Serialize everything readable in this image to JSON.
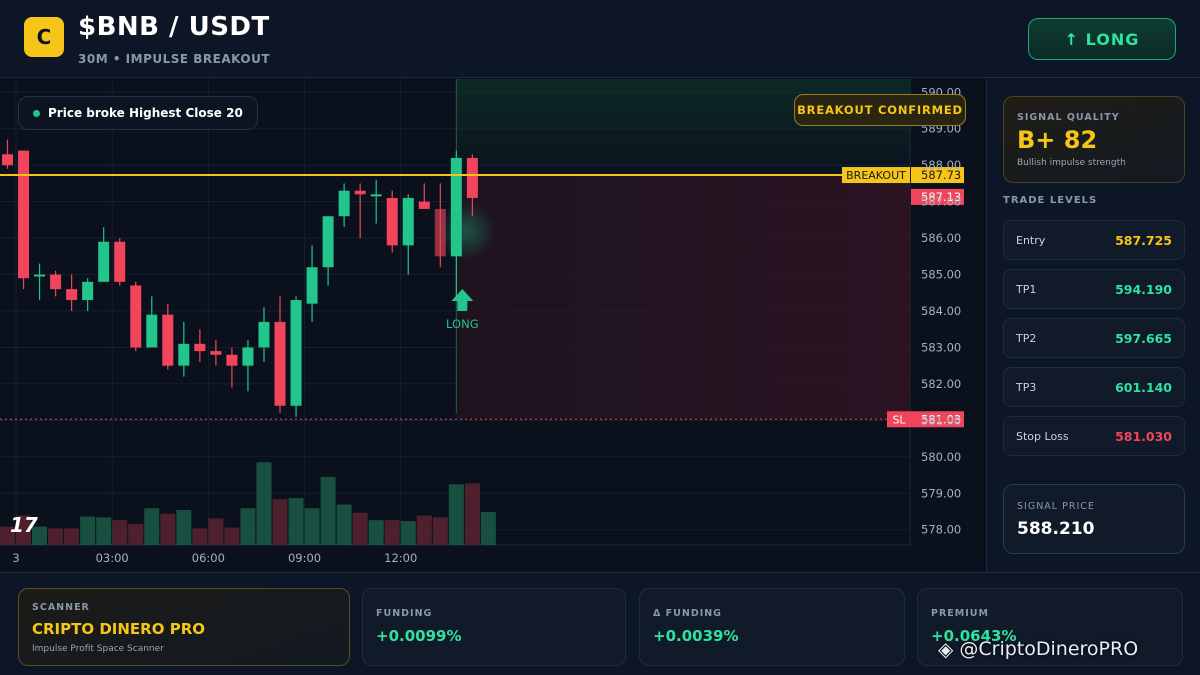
{
  "header": {
    "logo_letter": "C",
    "title": "$BNB / USDT",
    "subtitle": "30M • IMPULSE BREAKOUT",
    "long_button": "↑ LONG"
  },
  "chart": {
    "note": "Price broke Highest Close 20",
    "breakout_badge": "BREAKOUT CONFIRMED",
    "tv_logo": "17",
    "breakout_line_label": "BREAKOUT",
    "breakout_level": "587.73",
    "current_price_tag": "587.13",
    "sl_label": "SL",
    "sl_level": "581.03",
    "signal_arrow_label": "LONG",
    "colors": {
      "up": "#22c58b",
      "down": "#f2455b",
      "breakout": "#f5c518",
      "sl": "#f2455b"
    }
  },
  "chart_data": {
    "type": "candlestick",
    "price_axis_ticks": [
      "590.00",
      "589.00",
      "588.00",
      "587.00",
      "586.00",
      "585.00",
      "584.00",
      "583.00",
      "582.00",
      "581.00",
      "580.00",
      "579.00",
      "578.00"
    ],
    "ylim": [
      577.8,
      590.2
    ],
    "time_axis_ticks": [
      {
        "label": "3",
        "index": 1
      },
      {
        "label": "03:00",
        "index": 7
      },
      {
        "label": "06:00",
        "index": 13
      },
      {
        "label": "09:00",
        "index": 19
      },
      {
        "label": "12:00",
        "index": 25
      }
    ],
    "candles": [
      {
        "o": 588.3,
        "h": 588.7,
        "c": 588.0,
        "l": 587.9
      },
      {
        "o": 588.4,
        "h": 588.4,
        "c": 584.9,
        "l": 584.6
      },
      {
        "o": 585.0,
        "h": 585.3,
        "c": 585.0,
        "l": 584.3
      },
      {
        "o": 585.0,
        "h": 585.1,
        "c": 584.6,
        "l": 584.4
      },
      {
        "o": 584.6,
        "h": 585.0,
        "c": 584.3,
        "l": 584.0
      },
      {
        "o": 584.3,
        "h": 584.9,
        "c": 584.8,
        "l": 584.0
      },
      {
        "o": 584.8,
        "h": 586.3,
        "c": 585.9,
        "l": 584.8
      },
      {
        "o": 585.9,
        "h": 586.0,
        "c": 584.8,
        "l": 584.7
      },
      {
        "o": 584.7,
        "h": 584.8,
        "c": 583.0,
        "l": 582.9
      },
      {
        "o": 583.0,
        "h": 584.4,
        "c": 583.9,
        "l": 583.0
      },
      {
        "o": 583.9,
        "h": 584.2,
        "c": 582.5,
        "l": 582.4
      },
      {
        "o": 582.5,
        "h": 583.7,
        "c": 583.1,
        "l": 582.2
      },
      {
        "o": 583.1,
        "h": 583.5,
        "c": 582.9,
        "l": 582.6
      },
      {
        "o": 582.9,
        "h": 583.2,
        "c": 582.8,
        "l": 582.5
      },
      {
        "o": 582.8,
        "h": 583.0,
        "c": 582.5,
        "l": 581.9
      },
      {
        "o": 582.5,
        "h": 583.2,
        "c": 583.0,
        "l": 581.8
      },
      {
        "o": 583.0,
        "h": 584.1,
        "c": 583.7,
        "l": 582.6
      },
      {
        "o": 583.7,
        "h": 584.4,
        "c": 581.4,
        "l": 581.2
      },
      {
        "o": 581.4,
        "h": 584.4,
        "c": 584.3,
        "l": 581.1
      },
      {
        "o": 584.2,
        "h": 585.8,
        "c": 585.2,
        "l": 583.7
      },
      {
        "o": 585.2,
        "h": 586.6,
        "c": 586.6,
        "l": 584.7
      },
      {
        "o": 586.6,
        "h": 587.5,
        "c": 587.3,
        "l": 586.3
      },
      {
        "o": 587.3,
        "h": 587.5,
        "c": 587.2,
        "l": 586.0
      },
      {
        "o": 587.2,
        "h": 587.6,
        "c": 587.2,
        "l": 586.4
      },
      {
        "o": 587.1,
        "h": 587.3,
        "c": 585.8,
        "l": 585.6
      },
      {
        "o": 585.8,
        "h": 587.2,
        "c": 587.1,
        "l": 585.0
      },
      {
        "o": 587.0,
        "h": 587.5,
        "c": 586.8,
        "l": 586.8
      },
      {
        "o": 586.8,
        "h": 587.5,
        "c": 585.5,
        "l": 585.2
      },
      {
        "o": 585.5,
        "h": 588.4,
        "c": 588.2,
        "l": 584.4
      },
      {
        "o": 588.2,
        "h": 588.3,
        "c": 587.1,
        "l": 586.6
      }
    ],
    "volumes": [
      0.2,
      0.32,
      0.2,
      0.18,
      0.18,
      0.31,
      0.3,
      0.27,
      0.23,
      0.4,
      0.34,
      0.38,
      0.18,
      0.29,
      0.19,
      0.4,
      0.9,
      0.5,
      0.51,
      0.4,
      0.74,
      0.44,
      0.35,
      0.27,
      0.27,
      0.26,
      0.32,
      0.3,
      0.66,
      0.67,
      0.36
    ],
    "signal_index": 28
  },
  "right_panel": {
    "quality_label": "SIGNAL QUALITY",
    "quality_value": "B+ 82",
    "quality_sub": "Bullish impulse strength",
    "levels_title": "TRADE LEVELS",
    "levels": [
      {
        "label": "Entry",
        "value": "587.725",
        "color": "#f5c518"
      },
      {
        "label": "TP1",
        "value": "594.190",
        "color": "#2ee2a0"
      },
      {
        "label": "TP2",
        "value": "597.665",
        "color": "#2ee2a0"
      },
      {
        "label": "TP3",
        "value": "601.140",
        "color": "#2ee2a0"
      },
      {
        "label": "Stop Loss",
        "value": "581.030",
        "color": "#f2455b"
      }
    ],
    "signal_price_label": "SIGNAL PRICE",
    "signal_price_value": "588.210"
  },
  "bottom": {
    "scanner_label": "SCANNER",
    "scanner_name": "CRIPTO DINERO PRO",
    "scanner_sub": "Impulse Profit Space Scanner",
    "funding_label": "FUNDING",
    "funding_value": "+0.0099%",
    "dfunding_label": "Δ FUNDING",
    "dfunding_value": "+0.0039%",
    "premium_label": "PREMIUM",
    "premium_value": "+0.0643%"
  },
  "watermark": {
    "icon": "binance-icon",
    "text": "@CriptoDineroPRO"
  }
}
